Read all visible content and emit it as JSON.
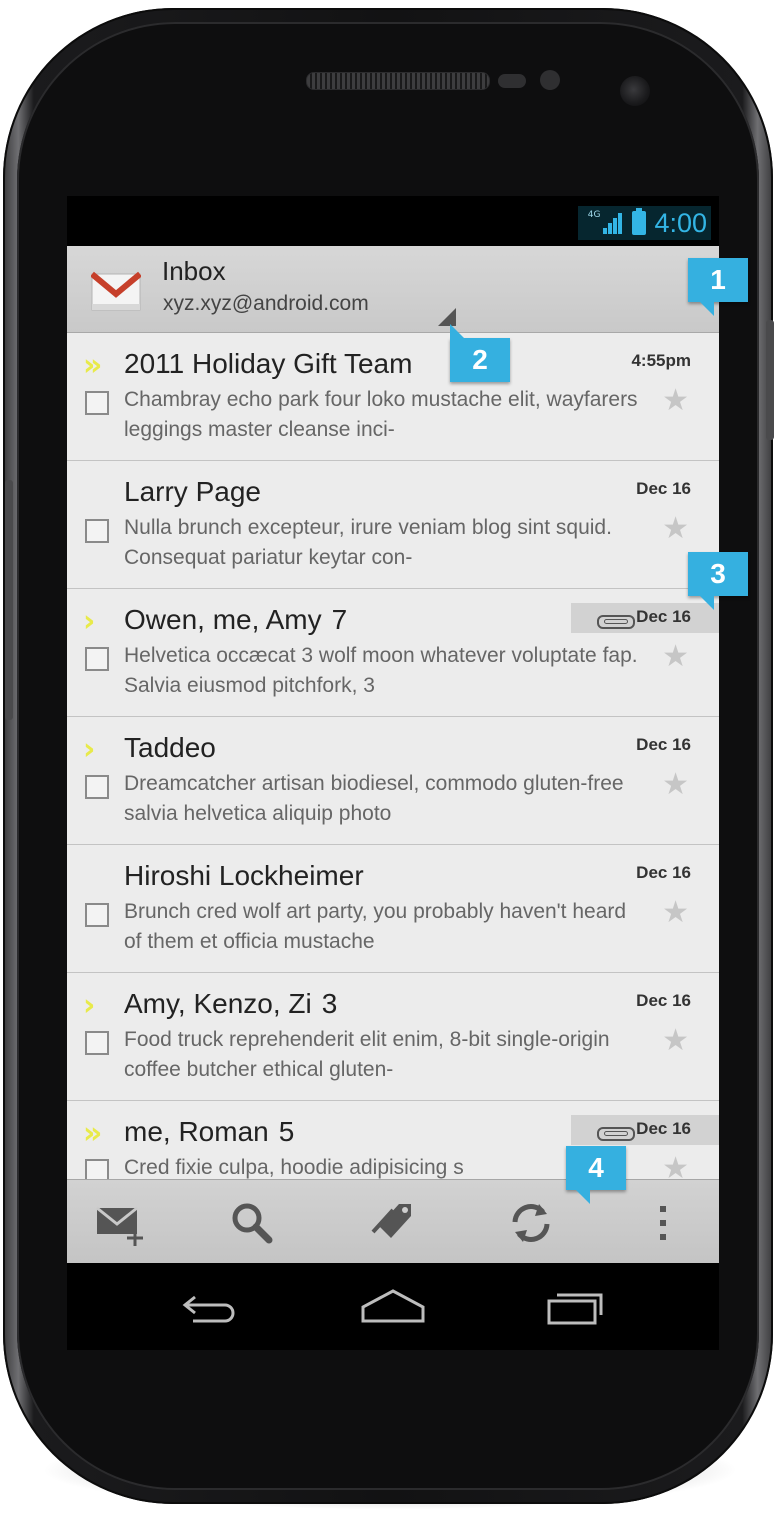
{
  "status_bar": {
    "network": "4G",
    "time": "4:00"
  },
  "header": {
    "title": "Inbox",
    "account": "xyz.xyz@android.com"
  },
  "colors": {
    "accent": "#33b5e5",
    "callout": "#35b0e0",
    "important_marker": "#e8ea4a"
  },
  "messages": [
    {
      "sender": "2011 Holiday Gift Team",
      "count": "",
      "date": "4:55pm",
      "snippet": "Chambray echo park four loko mustache elit, wayfarers leggings master cleanse inci-",
      "importance": "double",
      "attachment": false
    },
    {
      "sender": "Larry Page",
      "count": "",
      "date": "Dec 16",
      "snippet": "Nulla brunch excepteur, irure veniam blog sint squid. Consequat pariatur keytar con-",
      "importance": "none",
      "attachment": false
    },
    {
      "sender": "Owen, me, Amy",
      "count": "7",
      "date": "Dec 16",
      "snippet": "Helvetica occæcat 3 wolf moon whatever voluptate fap. Salvia eiusmod pitchfork, 3",
      "importance": "single",
      "attachment": true
    },
    {
      "sender": "Taddeo",
      "count": "",
      "date": "Dec 16",
      "snippet": "Dreamcatcher artisan biodiesel, commodo gluten-free salvia helvetica aliquip photo",
      "importance": "single",
      "attachment": false
    },
    {
      "sender": "Hiroshi Lockheimer",
      "count": "",
      "date": "Dec 16",
      "snippet": "Brunch cred wolf art party, you probably haven't heard of them et officia mustache",
      "importance": "none",
      "attachment": false
    },
    {
      "sender": "Amy, Kenzo, Zi",
      "count": "3",
      "date": "Dec 16",
      "snippet": "Food truck reprehenderit elit enim, 8-bit single-origin coffee butcher ethical gluten-",
      "importance": "single",
      "attachment": false
    },
    {
      "sender": "me, Roman",
      "count": "5",
      "date": "Dec 16",
      "snippet": "Cred fixie culpa, hoodie adipisicing s",
      "importance": "double",
      "attachment": true
    }
  ],
  "bottom_actions": [
    "compose-icon",
    "search-icon",
    "labels-icon",
    "refresh-icon",
    "overflow-menu-icon"
  ],
  "nav_buttons": [
    "back-icon",
    "home-icon",
    "recent-apps-icon"
  ],
  "callouts": [
    "1",
    "2",
    "3",
    "4"
  ]
}
